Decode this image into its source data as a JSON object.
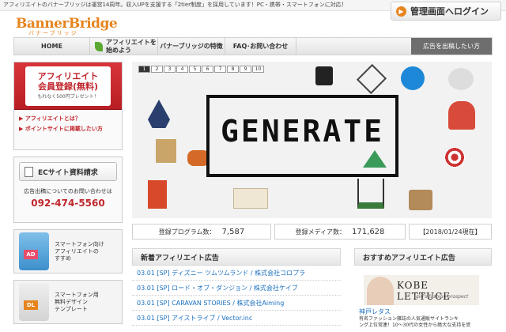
{
  "topbar": {
    "text": "アフィリエイトのバナーブリッジは運営14周年。収入UPを支援する「2tier制度」を採用しています！PC・携帯・スマートフォンに対応！"
  },
  "login": {
    "label": "管理画面へログイン"
  },
  "logo": {
    "main": "BannerBridge",
    "sub": "バナーブリッジ"
  },
  "nav": {
    "home": "HOME",
    "affiliate_l1": "アフィリエイトを",
    "affiliate_l2": "始めよう",
    "features": "バナーブリッジの特徴",
    "faq": "FAQ･お問い合わせ",
    "advertise": "広告を出稿したい方"
  },
  "signup": {
    "title1": "アフィリエイト",
    "title2": "会員登録(無料)",
    "sub": "もれなく500円プレゼント！",
    "link1": "アフィリエイトとは？",
    "link2": "ポイントサイトに掲載したい方"
  },
  "ec": {
    "button": "ECサイト資料請求",
    "question": "広告出稿についてのお問い合わせは",
    "tel": "092-474-5560"
  },
  "smart": {
    "badge": "AD",
    "l1": "スマートフォン向け",
    "l2": "アフィリエイトの",
    "l3": "すすめ"
  },
  "smart2": {
    "badge": "DL",
    "l1": "スマートフォン用",
    "l2": "無料デザイン",
    "l3": "テンプレート"
  },
  "hero": {
    "pages": [
      "1",
      "2",
      "3",
      "4",
      "5",
      "6",
      "7",
      "8",
      "9",
      "10"
    ],
    "current": "1",
    "title": "GENERATE"
  },
  "stats": {
    "programs_label": "登録プログラム数：",
    "programs": "7,587",
    "media_label": "登録メディア数：",
    "media": "171,628",
    "date": "【2018/01/24現在】"
  },
  "news": {
    "heading": "新着アフィリエイト広告",
    "items": [
      "03.01 [SP] ディズニー ツムツムランド / 株式会社コロプラ",
      "03.01 [SP] ロード・オブ・ダンジョン / 株式会社ケイブ",
      "03.01 [SP] CARAVAN STORIES / 株式会社Aiming",
      "03.01 [SP] アイストライブ / Vector.inc"
    ]
  },
  "recommend": {
    "heading": "おすすめアフィリエイト広告",
    "brand": "KOBE LETTUCE",
    "tagline": "girl's fashion prospect",
    "link": "神戸レタス",
    "desc1": "有名ファッション雑誌の人気通販サイトランキ",
    "desc2": "ング上位常連！10〜30代の女性から絶大な支持を受"
  },
  "colors": {
    "accent": "#e6841e",
    "red": "#c0262c",
    "link": "#1a6fbf"
  }
}
